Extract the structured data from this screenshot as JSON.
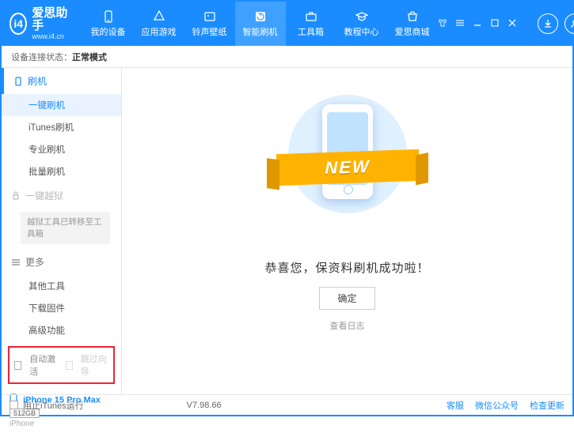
{
  "header": {
    "app_title": "爱思助手",
    "app_sub": "www.i4.cn",
    "nav": [
      {
        "label": "我的设备"
      },
      {
        "label": "应用游戏"
      },
      {
        "label": "铃声壁纸"
      },
      {
        "label": "智能刷机"
      },
      {
        "label": "工具箱"
      },
      {
        "label": "教程中心"
      },
      {
        "label": "爱思商城"
      }
    ]
  },
  "status": {
    "label": "设备连接状态：",
    "value": "正常模式"
  },
  "sidebar": {
    "flash_head": "刷机",
    "flash_items": [
      {
        "label": "一键刷机"
      },
      {
        "label": "iTunes刷机"
      },
      {
        "label": "专业刷机"
      },
      {
        "label": "批量刷机"
      }
    ],
    "jailbreak_head": "一键越狱",
    "jailbreak_note": "越狱工具已转移至工具箱",
    "more_head": "更多",
    "more_items": [
      {
        "label": "其他工具"
      },
      {
        "label": "下载固件"
      },
      {
        "label": "高级功能"
      }
    ],
    "check_auto": "自动激活",
    "check_skip": "跳过向导"
  },
  "device": {
    "model": "iPhone 15 Pro Max",
    "storage": "512GB",
    "type": "iPhone"
  },
  "main": {
    "ribbon": "NEW",
    "message": "恭喜您，保资料刷机成功啦！",
    "ok": "确定",
    "view_log": "查看日志"
  },
  "footer": {
    "block_itunes": "阻止iTunes运行",
    "version": "V7.98.66",
    "links": [
      "客服",
      "微信公众号",
      "检查更新"
    ]
  }
}
